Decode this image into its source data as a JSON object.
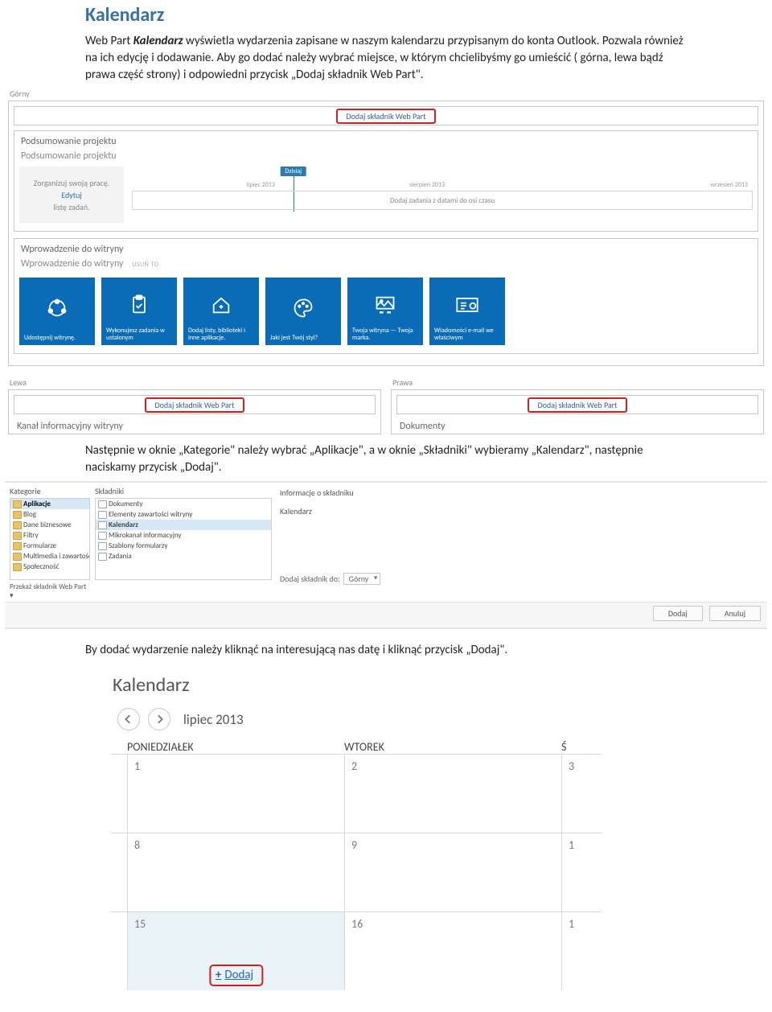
{
  "heading": "Kalendarz",
  "intro_prefix": "Web Part ",
  "intro_boldItalic": "Kalendarz",
  "intro_rest": " wyświetla wydarzenia zapisane w naszym kalendarzu przypisanym do konta Outlook. Pozwala również na ich edycję i dodawanie. Aby go dodać należy wybrać miejsce, w którym chcielibyśmy go umieścić ( górna, lewa bądź prawa część strony) i odpowiedni przycisk „Dodaj składnik Web Part\".",
  "para2": "Następnie w oknie „Kategorie\" należy wybrać „Aplikacje\", a w oknie „Składniki\" wybieramy „Kalendarz\", następnie naciskamy przycisk „Dodaj\".",
  "para3": "By dodać wydarzenie należy kliknąć na interesującą nas datę i kliknąć przycisk „Dodaj\".",
  "sp": {
    "zone_top": "Górny",
    "zone_left": "Lewa",
    "zone_right": "Prawa",
    "add_wp": "Dodaj składnik Web Part",
    "proj_title": "Podsumowanie projektu",
    "proj_sub": "Podsumowanie projektu",
    "proj_side1": "Zorganizuj swoją pracę.",
    "proj_side_link": "Edytuj",
    "proj_side2": "listę zadań.",
    "tl_today": "Dzisiaj",
    "tl_m1": "lipiec 2013",
    "tl_m2": "sierpień 2013",
    "tl_m3": "wrzesień 2013",
    "tl_bar": "Dodaj zadania z datami do osi czasu",
    "intro_title": "Wprowadzenie do witryny",
    "intro_sub": "Wprowadzenie do witryny",
    "usun": "USUŃ TO",
    "lewa_wp": "Kanał informacyjny witryny",
    "prawa_wp": "Dokumenty",
    "tiles": [
      {
        "cap": "Udostępnij witrynę."
      },
      {
        "cap": "Wykonujesz zadania w ustalonym"
      },
      {
        "cap": "Dodaj listy, biblioteki i inne aplikacje."
      },
      {
        "cap": "Jaki jest Twój styl?"
      },
      {
        "cap": "Twoja witryna — Twoja marka."
      },
      {
        "cap": "Wiadomości e-mail we właściwym"
      }
    ]
  },
  "picker": {
    "hdr_cat": "Kategorie",
    "hdr_parts": "Składniki",
    "hdr_info": "Informacje o składniku",
    "cats": [
      "Aplikacje",
      "Blog",
      "Dane biznesowe",
      "Filtry",
      "Formularze",
      "Multimedia i zawartość",
      "Społeczność"
    ],
    "parts": [
      "Dokumenty",
      "Elementy zawartości witryny",
      "Kalendarz",
      "Mikrokanał informacyjny",
      "Szablony formularzy",
      "Zadania"
    ],
    "info_title": "Kalendarz",
    "upload": "Przekaż składnik Web Part ▾",
    "add_to": "Dodaj składnik do:",
    "add_to_zone": "Górny",
    "btn_add": "Dodaj",
    "btn_cancel": "Anuluj"
  },
  "cal": {
    "title": "Kalendarz",
    "month": "lipiec 2013",
    "days": [
      "PONIEDZIAŁEK",
      "WTOREK",
      "Ś"
    ],
    "cells": [
      [
        "1",
        "2",
        "3"
      ],
      [
        "8",
        "9",
        "1"
      ],
      [
        "15",
        "16",
        "1"
      ]
    ],
    "add": "Dodaj"
  }
}
